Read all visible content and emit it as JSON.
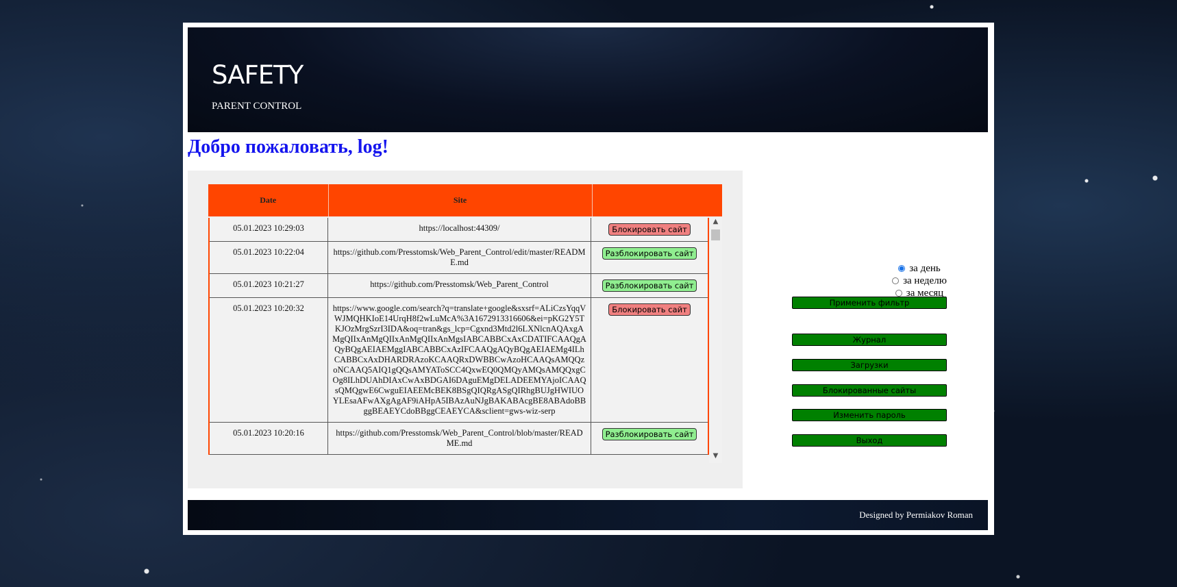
{
  "header": {
    "logo": "SAFETY",
    "tagline": "PARENT CONTROL"
  },
  "welcome": "Добро пожаловать, log!",
  "table": {
    "headers": {
      "date": "Date",
      "site": "Site",
      "action": ""
    },
    "rows": [
      {
        "date": "05.01.2023 10:29:03",
        "site": "https://localhost:44309/",
        "action": "Блокировать сайт",
        "action_type": "block"
      },
      {
        "date": "05.01.2023 10:22:04",
        "site": "https://github.com/Presstomsk/Web_Parent_Control/edit/master/README.md",
        "action": "Разблокировать сайт",
        "action_type": "unblock"
      },
      {
        "date": "05.01.2023 10:21:27",
        "site": "https://github.com/Presstomsk/Web_Parent_Control",
        "action": "Разблокировать сайт",
        "action_type": "unblock"
      },
      {
        "date": "05.01.2023 10:20:32",
        "site": "https://www.google.com/search?q=translate+google&sxsrf=ALiCzsYqqVWJMQHKIoE14UrqH8f2wLuMcA%3A1672913316606&ei=pKG2Y5TKJOzMrgSzrI3IDA&oq=tran&gs_lcp=Cgxnd3Mtd2l6LXNlcnAQAxgAMgQIIxAnMgQIIxAnMgQIIxAnMgsIABCABBCxAxCDATIFCAAQgAQyBQgAEIAEMggIABCABBCxAzIFCAAQgAQyBQgAEIAEMg4ILhCABBCxAxDHARDRAzoKCAAQRxDWBBCwAzoHCAAQsAMQQzoNCAAQ5AIQ1gQQsAMYAToSCC4QxwEQ0QMQyAMQsAMQQxgCOg8ILhDUAhDIAxCwAxBDGAI6DAguEMgDELADEEMYAjoICAAQsQMQgwE6CwguEIAEEMcBEK8BSgQIQRgASgQIRhgBUJgHWIUOYLEsaAFwAXgAgAF9iAHpA5IBAzAuNJgBAKABAcgBE8ABAdoBBggBEAEYCdoBBggCEAEYCA&sclient=gws-wiz-serp",
        "action": "Блокировать сайт",
        "action_type": "block"
      },
      {
        "date": "05.01.2023 10:20:16",
        "site": "https://github.com/Presstomsk/Web_Parent_Control/blob/master/README.md",
        "action": "Разблокировать сайт",
        "action_type": "unblock"
      }
    ]
  },
  "filters": {
    "options": [
      {
        "label": "за день",
        "checked": true
      },
      {
        "label": "за неделю",
        "checked": false
      },
      {
        "label": "за месяц",
        "checked": false
      }
    ],
    "apply_label": "Применить фильтр"
  },
  "menu": {
    "journal": "Журнал",
    "downloads": "Загрузки",
    "blocked_sites": "Блокированные сайты",
    "change_password": "Изменить пароль",
    "logout": "Выход"
  },
  "footer": {
    "credit": "Designed by Permiakov Roman"
  },
  "colors": {
    "table_header": "#ff4500",
    "button_green": "#008000",
    "block_button": "#f08080",
    "unblock_button": "#90ee90",
    "welcome_text": "#1515ee"
  }
}
